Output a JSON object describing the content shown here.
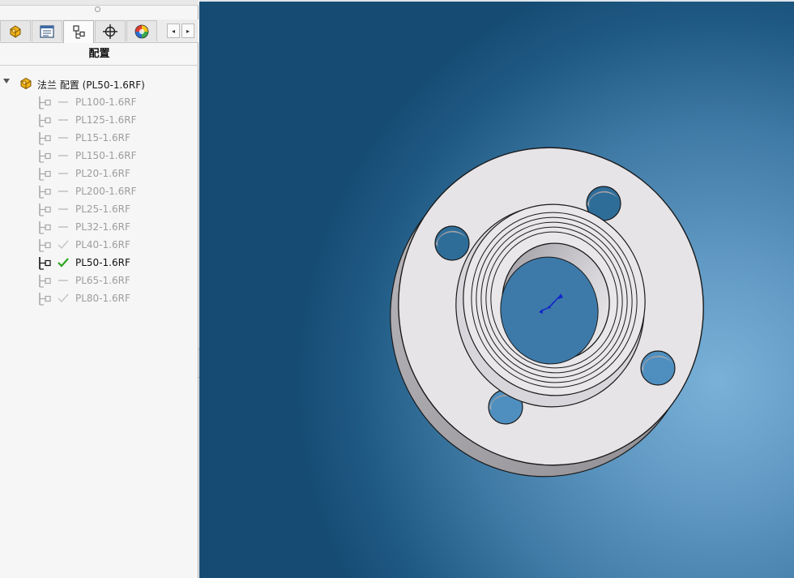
{
  "panel": {
    "title": "配置",
    "tabs": [
      {
        "name": "feature-manager-tab",
        "icon": "feature-tree-icon"
      },
      {
        "name": "property-manager-tab",
        "icon": "property-list-icon"
      },
      {
        "name": "configuration-manager-tab",
        "icon": "configuration-icon",
        "active": true
      },
      {
        "name": "dimxpert-manager-tab",
        "icon": "crosshair-icon"
      },
      {
        "name": "display-manager-tab",
        "icon": "appearance-sphere-icon"
      }
    ],
    "scroll_left": "◂",
    "scroll_right": "▸"
  },
  "tree": {
    "root_label": "法兰 配置  (PL50-1.6RF)",
    "root_icon": "part-configuration-icon",
    "configurations": [
      {
        "label": "PL100-1.6RF",
        "mark": "dash"
      },
      {
        "label": "PL125-1.6RF",
        "mark": "dash"
      },
      {
        "label": "PL15-1.6RF",
        "mark": "dash"
      },
      {
        "label": "PL150-1.6RF",
        "mark": "dash"
      },
      {
        "label": "PL20-1.6RF",
        "mark": "dash"
      },
      {
        "label": "PL200-1.6RF",
        "mark": "dash"
      },
      {
        "label": "PL25-1.6RF",
        "mark": "dash"
      },
      {
        "label": "PL32-1.6RF",
        "mark": "dash"
      },
      {
        "label": "PL40-1.6RF",
        "mark": "check-grey"
      },
      {
        "label": "PL50-1.6RF",
        "mark": "check-green",
        "active": true
      },
      {
        "label": "PL65-1.6RF",
        "mark": "dash"
      },
      {
        "label": "PL80-1.6RF",
        "mark": "check-grey"
      }
    ]
  },
  "viewport": {
    "model": "flange-3d-model",
    "origin_icon": "origin-triad-icon",
    "colors": {
      "background_light": "#79b1d8",
      "background_dark": "#164c74",
      "model_face": "#e6e4e7",
      "model_edge": "#1a1a1a",
      "check_green": "#2ba51f"
    }
  }
}
